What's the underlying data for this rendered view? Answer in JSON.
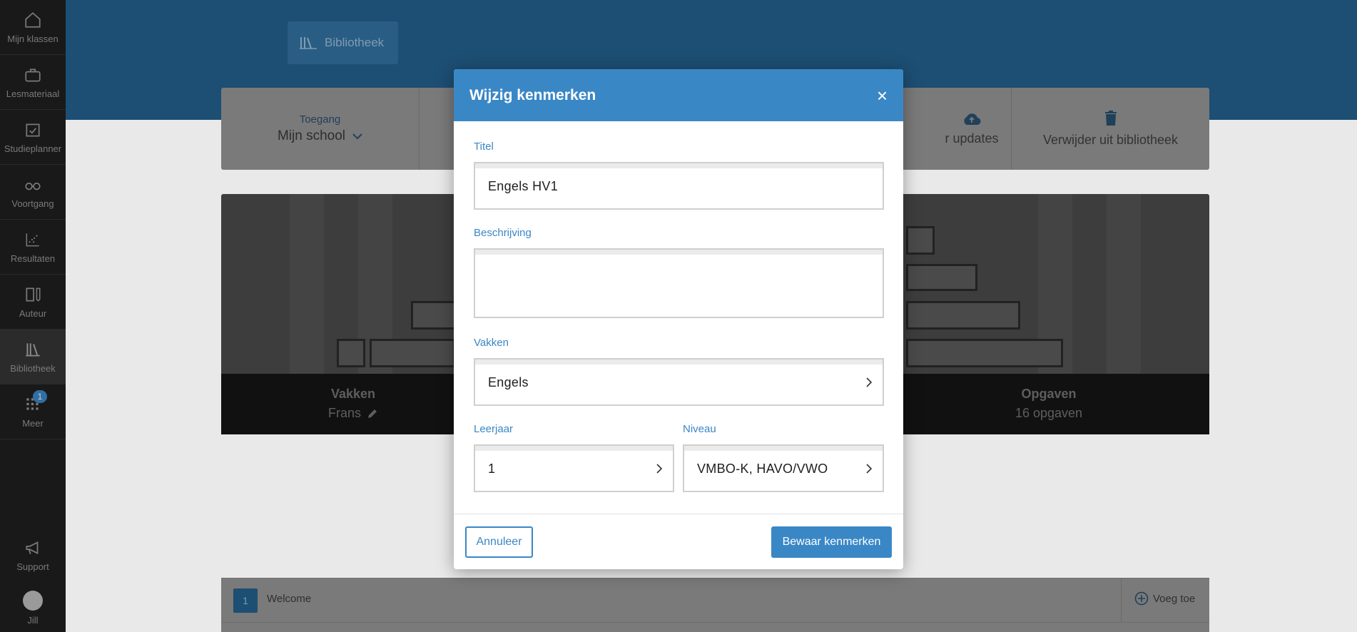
{
  "sidebar": {
    "items": [
      {
        "label": "Mijn klassen",
        "icon": "home-icon"
      },
      {
        "label": "Lesmateriaal",
        "icon": "briefcase-icon"
      },
      {
        "label": "Studieplanner",
        "icon": "calendar-check-icon"
      },
      {
        "label": "Voortgang",
        "icon": "glasses-icon"
      },
      {
        "label": "Resultaten",
        "icon": "scatter-icon"
      },
      {
        "label": "Auteur",
        "icon": "author-icon"
      },
      {
        "label": "Bibliotheek",
        "icon": "library-icon",
        "active": true
      },
      {
        "label": "Meer",
        "icon": "grid-icon",
        "badge": "1"
      }
    ],
    "bottom": [
      {
        "label": "Support",
        "icon": "megaphone-icon"
      },
      {
        "label": "Jill",
        "icon": "avatar"
      }
    ]
  },
  "header": {
    "tab_label": "Bibliotheek"
  },
  "toolbar": {
    "access_label": "Toegang",
    "access_value": "Mijn school",
    "updates_label": "r updates",
    "delete_label": "Verwijder uit bibliotheek"
  },
  "hero": {
    "vakken_label": "Vakken",
    "vakken_value": "Frans",
    "opgaven_label": "Opgaven",
    "opgaven_value": "16 opgaven"
  },
  "list": {
    "rows": [
      {
        "number": "1",
        "title": "Welcome",
        "action": "Voeg toe"
      }
    ]
  },
  "modal": {
    "title": "Wijzig kenmerken",
    "close": "×",
    "titel_label": "Titel",
    "titel_value": "Engels HV1",
    "beschrijving_label": "Beschrijving",
    "beschrijving_value": "",
    "vakken_label": "Vakken",
    "vakken_value": "Engels",
    "leerjaar_label": "Leerjaar",
    "leerjaar_value": "1",
    "niveau_label": "Niveau",
    "niveau_value": "VMBO-K, HAVO/VWO",
    "cancel_label": "Annuleer",
    "save_label": "Bewaar kenmerken"
  },
  "colors": {
    "accent": "#3a87c6",
    "sidebar_bg": "#191919",
    "header_band": "#1d4e73"
  }
}
